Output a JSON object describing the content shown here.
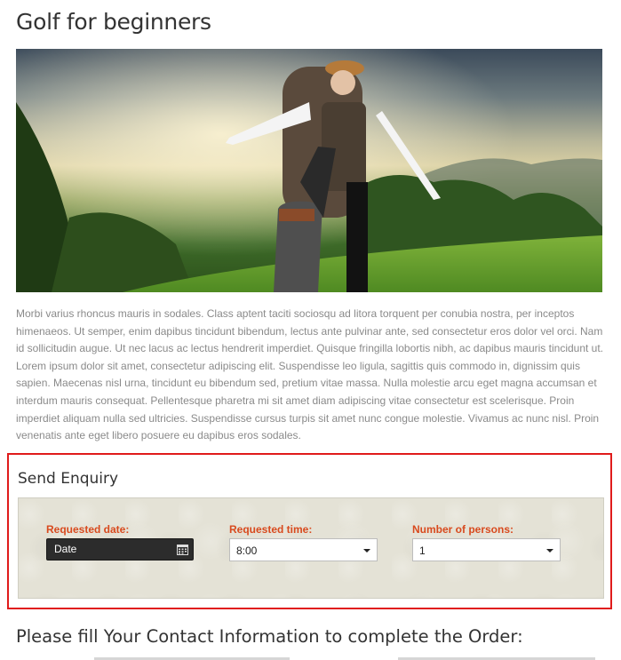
{
  "page": {
    "title": "Golf for beginners",
    "hero_image_alt": "",
    "body_text": "Morbi varius rhoncus mauris in sodales. Class aptent taciti sociosqu ad litora torquent per conubia nostra, per inceptos himenaeos. Ut semper, enim dapibus tincidunt bibendum, lectus ante pulvinar ante, sed consectetur eros dolor vel orci. Nam id sollicitudin augue. Ut nec lacus ac lectus hendrerit imperdiet. Quisque fringilla lobortis nibh, ac dapibus mauris tincidunt ut. Lorem ipsum dolor sit amet, consectetur adipiscing elit. Suspendisse leo ligula, sagittis quis commodo in, dignissim quis sapien. Maecenas nisl urna, tincidunt eu bibendum sed, pretium vitae massa. Nulla molestie arcu eget magna accumsan et interdum mauris consequat. Pellentesque pharetra mi sit amet diam adipiscing vitae consectetur est scelerisque. Proin imperdiet aliquam nulla sed ultricies. Suspendisse cursus turpis sit amet nunc congue molestie. Vivamus ac nunc nisl. Proin venenatis ante eget libero posuere eu dapibus eros sodales."
  },
  "enquiry": {
    "title": "Send Enquiry",
    "date": {
      "label": "Requested date:",
      "placeholder": "Date",
      "icon": "calendar-icon"
    },
    "time": {
      "label": "Requested time:",
      "value": "8:00",
      "icon": "caret-down-icon"
    },
    "persons": {
      "label": "Number of persons:",
      "value": "1",
      "icon": "caret-down-icon"
    }
  },
  "contact": {
    "heading": "Please fill Your Contact Information to complete the Order:"
  },
  "colors": {
    "label_accent": "#d84a1e",
    "highlight_border": "#e01b1b",
    "panel_bg": "#e4e2d6",
    "date_input_bg": "#2c2c2c"
  }
}
